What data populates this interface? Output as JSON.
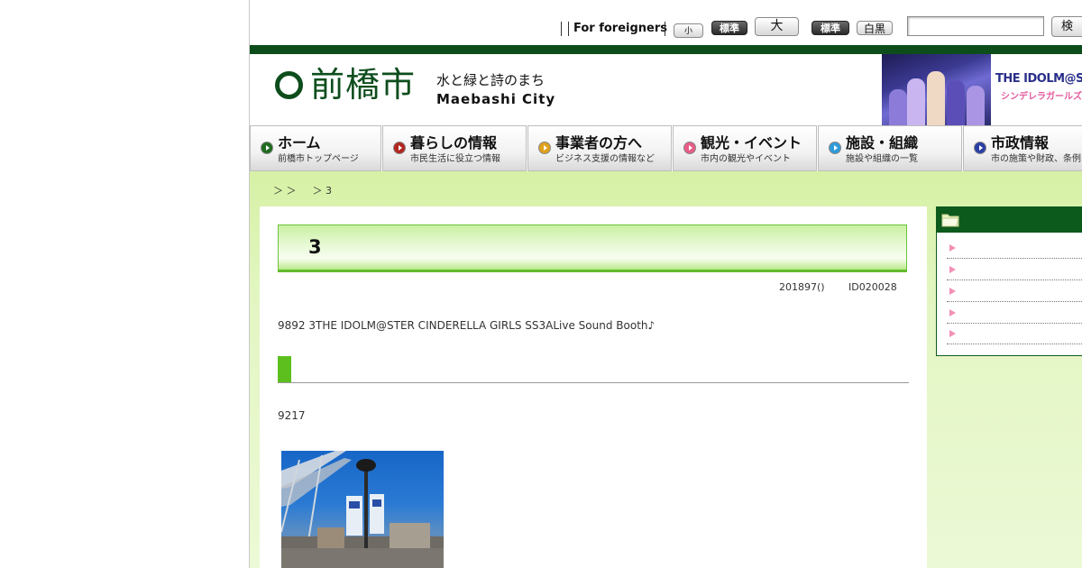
{
  "utility": {
    "foreign_link": "For foreigners",
    "font_small": "小",
    "font_standard": "標準",
    "font_large": "大",
    "color_standard": "標準",
    "color_bw": "白黒",
    "search_button": "検 索",
    "search_value": ""
  },
  "header": {
    "logo_kanji": "前橋市",
    "tagline": "水と緑と詩のまち",
    "english": "Maebashi City",
    "banner_logo": "THE IDOLM@STER",
    "banner_sub": "シンデレラガールズ"
  },
  "nav": [
    {
      "title": "ホーム",
      "sub": "前橋市トップページ",
      "color": "#1f6b1f"
    },
    {
      "title": "暮らしの情報",
      "sub": "市民生活に役立つ情報",
      "color": "#b3261e"
    },
    {
      "title": "事業者の方へ",
      "sub": "ビジネス支援の情報など",
      "color": "#e0a11b"
    },
    {
      "title": "観光・イベント",
      "sub": "市内の観光やイベント",
      "color": "#e85c86"
    },
    {
      "title": "施設・組織",
      "sub": "施設や組織の一覧",
      "color": "#2f9bd8"
    },
    {
      "title": "市政情報",
      "sub": "市の施策や財政、条例",
      "color": "#2a3fa3"
    }
  ],
  "breadcrumb": "＞ ＞  　＞ 3",
  "page": {
    "title": "3",
    "date": "201897()",
    "id": "ID020028",
    "intro": "9892  3THE IDOLM@STER CINDERELLA GIRLS SS3ALive Sound Booth♪",
    "body": "9217"
  },
  "sidebar": {
    "items": [
      "",
      "",
      "",
      "",
      ""
    ]
  },
  "colors": {
    "header_green": "#0d4d1c",
    "content_bg": "#d6f1a5",
    "accent_green": "#5cbf1e"
  }
}
